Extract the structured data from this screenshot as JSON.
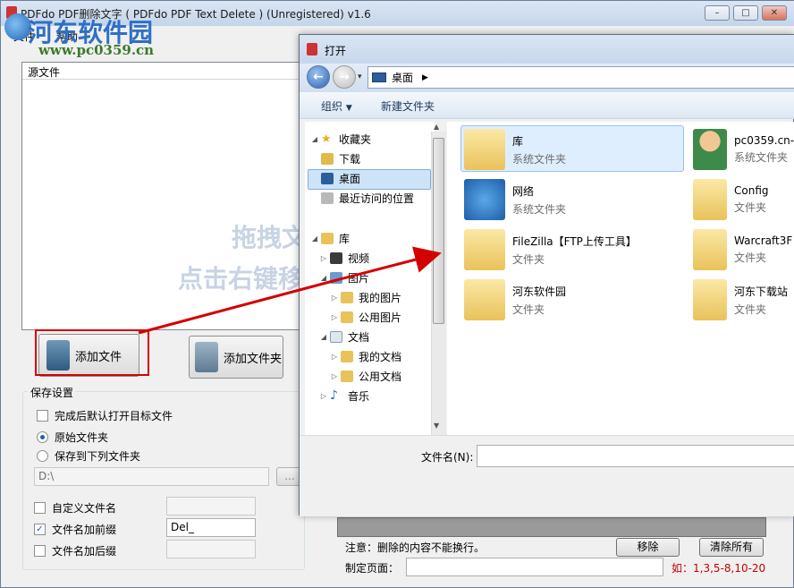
{
  "main": {
    "title": "PDFdo PDF删除文字 ( PDFdo PDF Text Delete ) (Unregistered) v1.6",
    "menu": [
      "文件",
      "帮助"
    ],
    "watermark": {
      "text": "河东软件园",
      "url": "www.pc0359.cn"
    },
    "file_list": {
      "header": "源文件",
      "hint_line1": "拖拽文",
      "hint_line2": "点击右键移"
    },
    "buttons": {
      "add_file": "添加文件",
      "add_folder": "添加文件夹"
    },
    "save_settings": {
      "title": "保存设置",
      "open_after": "完成后默认打开目标文件",
      "original_folder": "原始文件夹",
      "save_to_folder": "保存到下列文件夹",
      "folder_path": "D:\\",
      "browse": "...",
      "custom_name": "自定义文件名",
      "add_prefix": "文件名加前缀",
      "prefix_value": "Del_",
      "add_suffix": "文件名加后缀"
    },
    "note": "注意：删除的内容不能换行。",
    "remove_button": "移除",
    "clear_button": "清除所有",
    "page_label": "制定页面：",
    "page_hint": "如：1,3,5-8,10-20",
    "colors": {
      "accent_red": "#d40000",
      "hint_red": "#c80000"
    }
  },
  "dialog": {
    "title": "打开",
    "address": "桌面",
    "organize": "组织",
    "new_folder": "新建文件夹",
    "nav": {
      "favorites": "收藏夹",
      "downloads": "下载",
      "desktop": "桌面",
      "recent": "最近访问的位置",
      "libraries": "库",
      "videos": "视频",
      "pictures": "图片",
      "my_pictures": "我的图片",
      "public_pictures": "公用图片",
      "documents": "文档",
      "my_documents": "我的文档",
      "public_documents": "公用文档",
      "music": "音乐"
    },
    "items": [
      {
        "name": "库",
        "type": "系统文件夹"
      },
      {
        "name": "pc0359.cn-",
        "type": "系统文件夹"
      },
      {
        "name": "网络",
        "type": "系统文件夹"
      },
      {
        "name": "Config",
        "type": "文件夹"
      },
      {
        "name": "FileZilla【FTP上传工具】",
        "type": "文件夹"
      },
      {
        "name": "Warcraft3F",
        "type": "文件夹"
      },
      {
        "name": "河东软件园",
        "type": "文件夹"
      },
      {
        "name": "河东下载站",
        "type": "文件夹"
      }
    ],
    "filename_label": "文件名(N):"
  }
}
